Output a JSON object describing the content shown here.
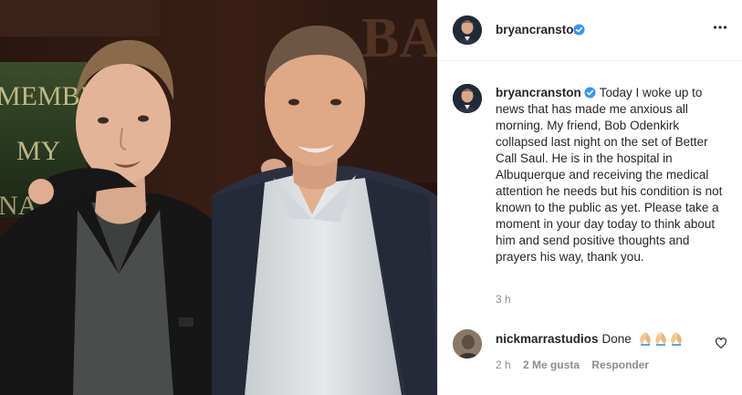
{
  "post": {
    "username": "bryancranston",
    "verified": true,
    "more_icon": "more-horizontal-icon",
    "caption": "Today I woke up to news that has made me anxious all morning. My friend, Bob Odenkirk collapsed last night on the set of Better Call Saul. He is in the hospital in Albuquerque and receiving the medical attention he needs but his condition is not known to the public as yet. Please take a moment in your day today to think about him and send positive thoughts and prayers his way, thank you.",
    "time": "3 h"
  },
  "photo": {
    "backdrop_text": [
      "BA",
      "MEMBE",
      "MY",
      "NA"
    ]
  },
  "comment": {
    "username": "nickmarrastudios",
    "text": "Done",
    "emoji": [
      "folded-hands-emoji",
      "folded-hands-emoji",
      "folded-hands-emoji"
    ],
    "time": "2 h",
    "likes": "2 Me gusta",
    "reply": "Responder",
    "like_icon": "heart-outline-icon"
  },
  "colors": {
    "verified": "#3897f0",
    "muted": "#8e8e8e",
    "border": "#efefef"
  }
}
